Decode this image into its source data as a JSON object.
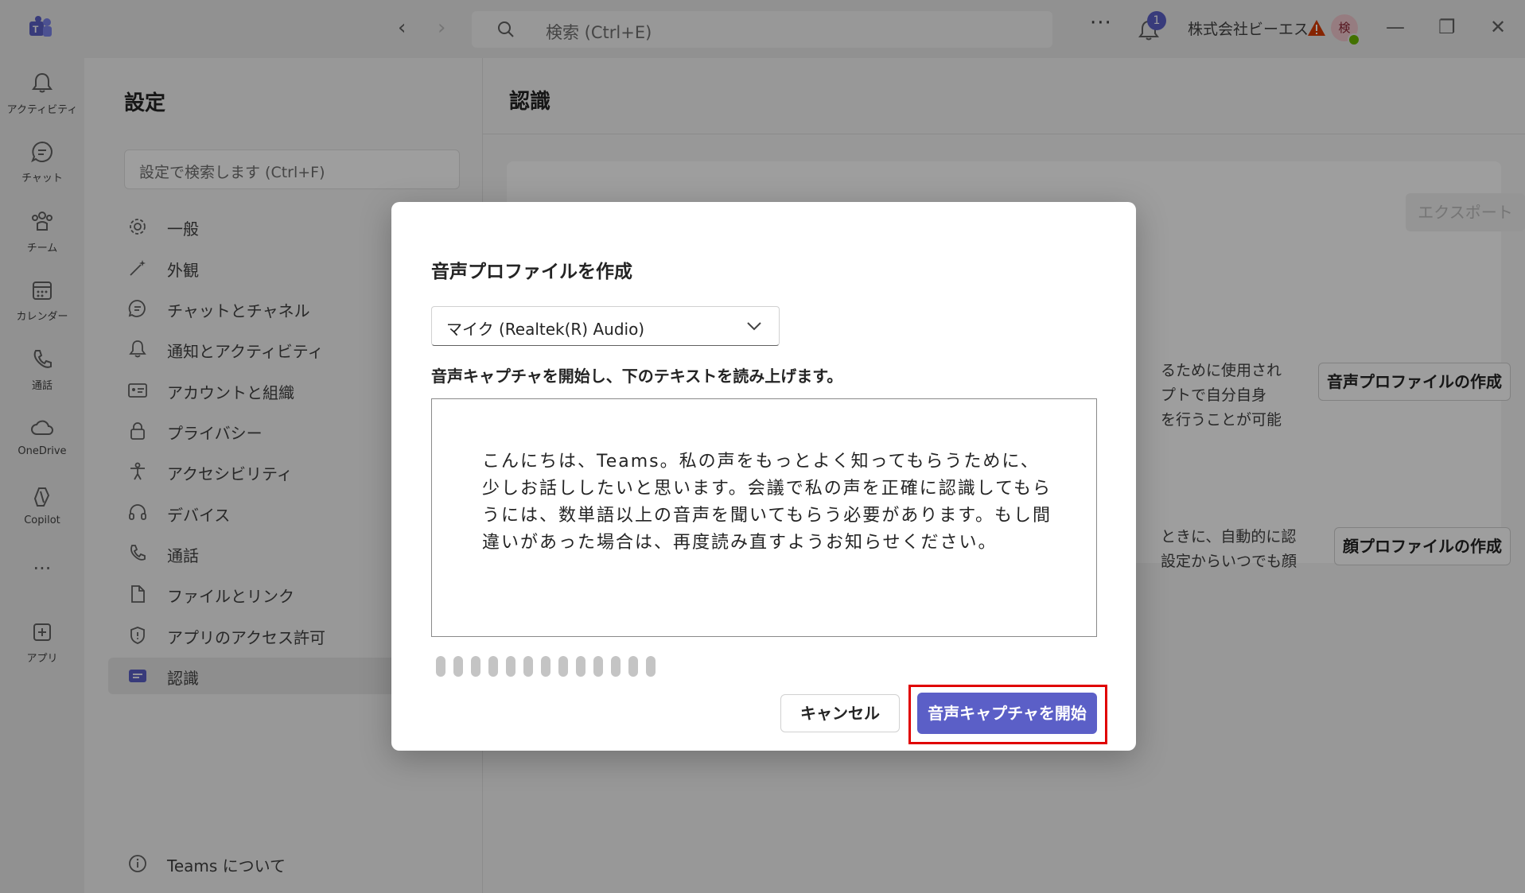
{
  "titlebar": {
    "search_placeholder": "検索 (Ctrl+E)",
    "notification_count": "1",
    "org_name": "株式会社ビーエス...",
    "avatar_initial": "検"
  },
  "rail": {
    "items": [
      {
        "label": "アクティビティ",
        "icon": "bell-icon"
      },
      {
        "label": "チャット",
        "icon": "chat-icon"
      },
      {
        "label": "チーム",
        "icon": "teams-icon"
      },
      {
        "label": "カレンダー",
        "icon": "calendar-icon"
      },
      {
        "label": "通話",
        "icon": "phone-icon"
      },
      {
        "label": "OneDrive",
        "icon": "cloud-icon"
      },
      {
        "label": "Copilot",
        "icon": "copilot-icon"
      },
      {
        "label": "アプリ",
        "icon": "apps-icon"
      }
    ]
  },
  "settings": {
    "title": "設定",
    "search_placeholder": "設定で検索します (Ctrl+F)",
    "menu": [
      {
        "label": "一般",
        "icon": "gear-icon"
      },
      {
        "label": "外観",
        "icon": "wand-icon"
      },
      {
        "label": "チャットとチャネル",
        "icon": "chat-icon"
      },
      {
        "label": "通知とアクティビティ",
        "icon": "bell-icon"
      },
      {
        "label": "アカウントと組織",
        "icon": "id-card-icon"
      },
      {
        "label": "プライバシー",
        "icon": "lock-icon"
      },
      {
        "label": "アクセシビリティ",
        "icon": "accessibility-icon"
      },
      {
        "label": "デバイス",
        "icon": "headset-icon"
      },
      {
        "label": "通話",
        "icon": "phone-icon"
      },
      {
        "label": "ファイルとリンク",
        "icon": "file-icon"
      },
      {
        "label": "アプリのアクセス許可",
        "icon": "shield-icon"
      },
      {
        "label": "認識",
        "icon": "recognition-icon"
      }
    ],
    "about": "Teams について"
  },
  "main": {
    "title": "認識",
    "export_label": "エクスポート",
    "voice_text_fragment": "るために使用され\nプトで自分自身\nを行うことが可能",
    "voice_button": "音声プロファイルの作成",
    "face_text_fragment": "ときに、自動的に認\n設定からいつでも顔",
    "face_button": "顔プロファイルの作成"
  },
  "dialog": {
    "title": "音声プロファイルを作成",
    "mic_selected": "マイク (Realtek(R) Audio)",
    "instruction": "音声キャプチャを開始し、下のテキストを読み上げます。",
    "read_text": "こんにちは、Teams。私の声をもっとよく知ってもらうために、少しお話ししたいと思います。会議で私の声を正確に認識してもらうには、数単語以上の音声を聞いてもらう必要があります。もし間違いがあった場合は、再度読み直すようお知らせください。",
    "level_meter_level": 0,
    "cancel_label": "キャンセル",
    "start_label": "音声キャプチャを開始",
    "accent_color": "#5b5fc7",
    "highlight_color": "#e00000"
  }
}
